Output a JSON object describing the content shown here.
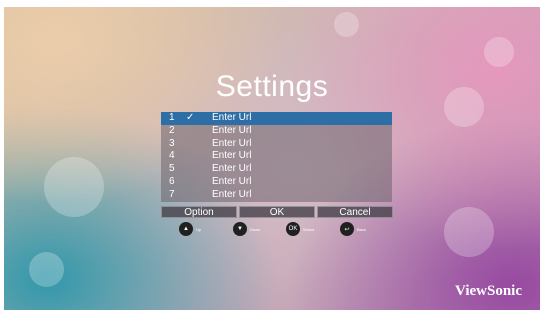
{
  "screen": {
    "title": "Settings",
    "rows": [
      {
        "number": "1",
        "check": "✓",
        "label": "Enter Url",
        "selected": true
      },
      {
        "number": "2",
        "check": "",
        "label": "Enter Url",
        "selected": false
      },
      {
        "number": "3",
        "check": "",
        "label": "Enter Url",
        "selected": false
      },
      {
        "number": "4",
        "check": "",
        "label": "Enter Url",
        "selected": false
      },
      {
        "number": "5",
        "check": "",
        "label": "Enter Url",
        "selected": false
      },
      {
        "number": "6",
        "check": "",
        "label": "Enter Url",
        "selected": false
      },
      {
        "number": "7",
        "check": "",
        "label": "Enter Url",
        "selected": false
      }
    ],
    "buttons": {
      "option": "Option",
      "ok": "OK",
      "cancel": "Cancel"
    },
    "hints": {
      "up": {
        "icon": "▲",
        "label": "Up"
      },
      "down": {
        "icon": "▼",
        "label": "Down"
      },
      "select": {
        "icon": "OK",
        "label": "Select"
      },
      "back": {
        "icon": "↩",
        "label": "Back"
      }
    },
    "brand": "ViewSonic"
  },
  "colors": {
    "selected_row": "#2e6ea6",
    "hint_circle": "#202020"
  }
}
